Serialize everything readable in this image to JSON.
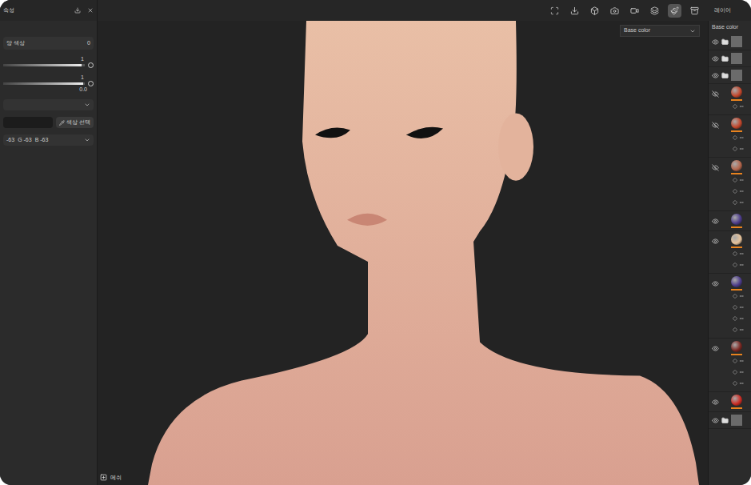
{
  "left_panel": {
    "title": "속성",
    "rows": [
      {
        "kind": "label",
        "label": "양 색상",
        "value": "0"
      },
      {
        "kind": "slider",
        "value": "1",
        "level": 0.96
      },
      {
        "kind": "slider",
        "value": "1",
        "sub": "0.0",
        "level": 0.98
      },
      {
        "kind": "dropdown",
        "value": ""
      }
    ],
    "pick_button": "색상 선택",
    "rgb": [
      "-63",
      "G -63",
      "B -63"
    ]
  },
  "toolbar": {
    "tools": [
      {
        "selected": false
      },
      {
        "selected": false
      },
      {
        "selected": false
      },
      {
        "selected": false
      },
      {
        "selected": false
      },
      {
        "selected": false
      },
      {
        "selected": true
      },
      {
        "selected": false
      }
    ],
    "panel_title": "레이어"
  },
  "viewport": {
    "channel": "Base color",
    "mesh_label": "메쉬"
  },
  "layers_panel": {
    "channel": "Base color",
    "layers": [
      {
        "kind": "folder",
        "visible": true,
        "effects": 0,
        "color": "#6b6b6b"
      },
      {
        "kind": "folder",
        "visible": true,
        "effects": 0,
        "color": "#6b6b6b"
      },
      {
        "kind": "folder",
        "visible": true,
        "effects": 0,
        "color": "#6b6b6b"
      },
      {
        "kind": "fill",
        "visible": false,
        "effects": 1,
        "color": "#c2452a"
      },
      {
        "kind": "fill",
        "visible": false,
        "effects": 2,
        "color": "#c2452a"
      },
      {
        "kind": "fill",
        "visible": false,
        "effects": 3,
        "color": "#b3644a"
      },
      {
        "kind": "fill",
        "visible": true,
        "effects": 0,
        "color": "#4b3a8a"
      },
      {
        "kind": "fill",
        "visible": true,
        "effects": 2,
        "color": "#e6c29a"
      },
      {
        "kind": "fill",
        "visible": true,
        "effects": 4,
        "color": "#4b3a8a"
      },
      {
        "kind": "fill",
        "visible": true,
        "effects": 3,
        "color": "#7a2620"
      },
      {
        "kind": "fill",
        "visible": true,
        "effects": 0,
        "color": "#cc2a22"
      },
      {
        "kind": "folder",
        "visible": true,
        "effects": 0,
        "color": "#6b6b6b"
      }
    ]
  }
}
